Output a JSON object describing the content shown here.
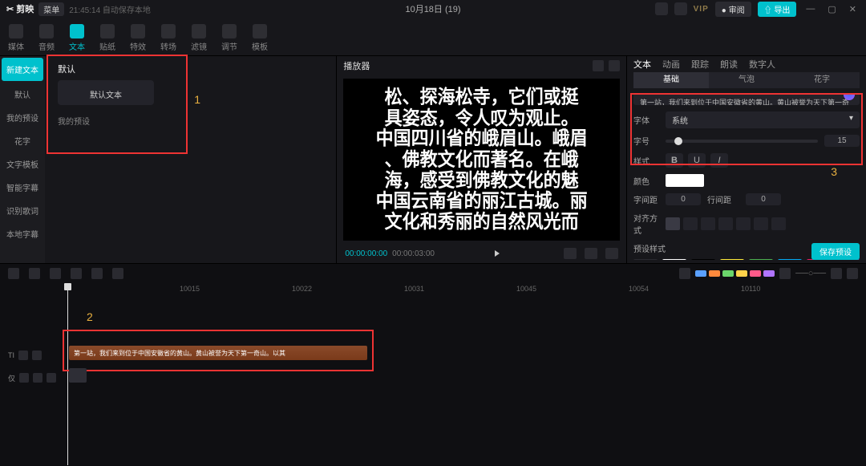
{
  "title_bar": {
    "logo": "剪映",
    "menu": "菜单",
    "meta": "21:45:14 自动保存本地",
    "center": "10月18日 (19)",
    "vip": "VIP",
    "review": "● 审阅",
    "export": "⇧ 导出"
  },
  "toolbar": [
    {
      "k": "media",
      "l": "媒体"
    },
    {
      "k": "audio",
      "l": "音频"
    },
    {
      "k": "text",
      "l": "文本"
    },
    {
      "k": "sticker",
      "l": "贴纸"
    },
    {
      "k": "effect",
      "l": "特效"
    },
    {
      "k": "transition",
      "l": "转场"
    },
    {
      "k": "filter",
      "l": "滤镜"
    },
    {
      "k": "adjust",
      "l": "调节"
    },
    {
      "k": "template",
      "l": "模板"
    }
  ],
  "toolbar_active": "text",
  "left_nav": [
    {
      "k": "new",
      "l": "新建文本"
    },
    {
      "k": "default",
      "l": "默认"
    },
    {
      "k": "preset",
      "l": "我的预设"
    },
    {
      "k": "fancy",
      "l": "花字"
    },
    {
      "k": "tmpl",
      "l": "文字模板"
    },
    {
      "k": "smart",
      "l": "智能字幕"
    },
    {
      "k": "rec",
      "l": "识别歌词"
    },
    {
      "k": "local",
      "l": "本地字幕"
    }
  ],
  "left_nav_active": "new",
  "left": {
    "header": "默认",
    "card": "默认文本",
    "preset": "我的预设",
    "num": "1"
  },
  "preview": {
    "title": "播放器",
    "text": "松、探海松寺，它们或挺\n具姿态，令人叹为观止。\n中国四川省的峨眉山。峨眉\n、佛教文化而著名。在峨\n海，感受到佛教文化的魅\n中国云南省的丽江古城。丽\n文化和秀丽的自然风光而",
    "cur": "00:00:00:00",
    "dur": "00:00:03:00"
  },
  "right": {
    "tabs": [
      "文本",
      "动画",
      "跟踪",
      "朗读",
      "数字人"
    ],
    "tab_active": "文本",
    "subtabs": [
      "基础",
      "气泡",
      "花字"
    ],
    "sub_active": "基础",
    "textarea": "第一站，我们来到位于中国安徽省的黄山。黄山被誉为天下第一奇山。以其奇松、怪石、云海、温泉四绝名于世。在黄山的路上，你可以看到许多奇松。如迎客松、黑虎松、探海松等。它们或挺拔、或苍劲、或婀娜、各具姿态，令人叹为观止。\n第二站，我们来到位于中国四川省的峨眉山。峨眉山是中国佛教的重要圣地",
    "font_label": "字体",
    "font_value": "系统",
    "size_label": "字号",
    "size_value": "15",
    "style_label": "样式",
    "bold": "B",
    "underline": "U",
    "italic": "I",
    "color_label": "颜色",
    "spacing_label": "字间距",
    "spacing_value": "0",
    "line_label": "行间距",
    "line_value": "0",
    "align_label": "对齐方式",
    "preset_label": "预设样式",
    "save": "保存预设",
    "num": "3"
  },
  "timeline": {
    "ticks": [
      "",
      "10015",
      "10022",
      "10031",
      "10045",
      "10054",
      "10110"
    ],
    "text_clip": "第一站，我们来到位于中国安徽省的黄山。黄山被誉为天下第一奇山。以其",
    "track_text_label": "TI",
    "track_vid_label": "仅",
    "num": "2"
  },
  "chips": [
    "#5aa0ff",
    "#ff8a3d",
    "#6bd66b",
    "#ffd24a",
    "#ff5a8a",
    "#b074ff"
  ]
}
